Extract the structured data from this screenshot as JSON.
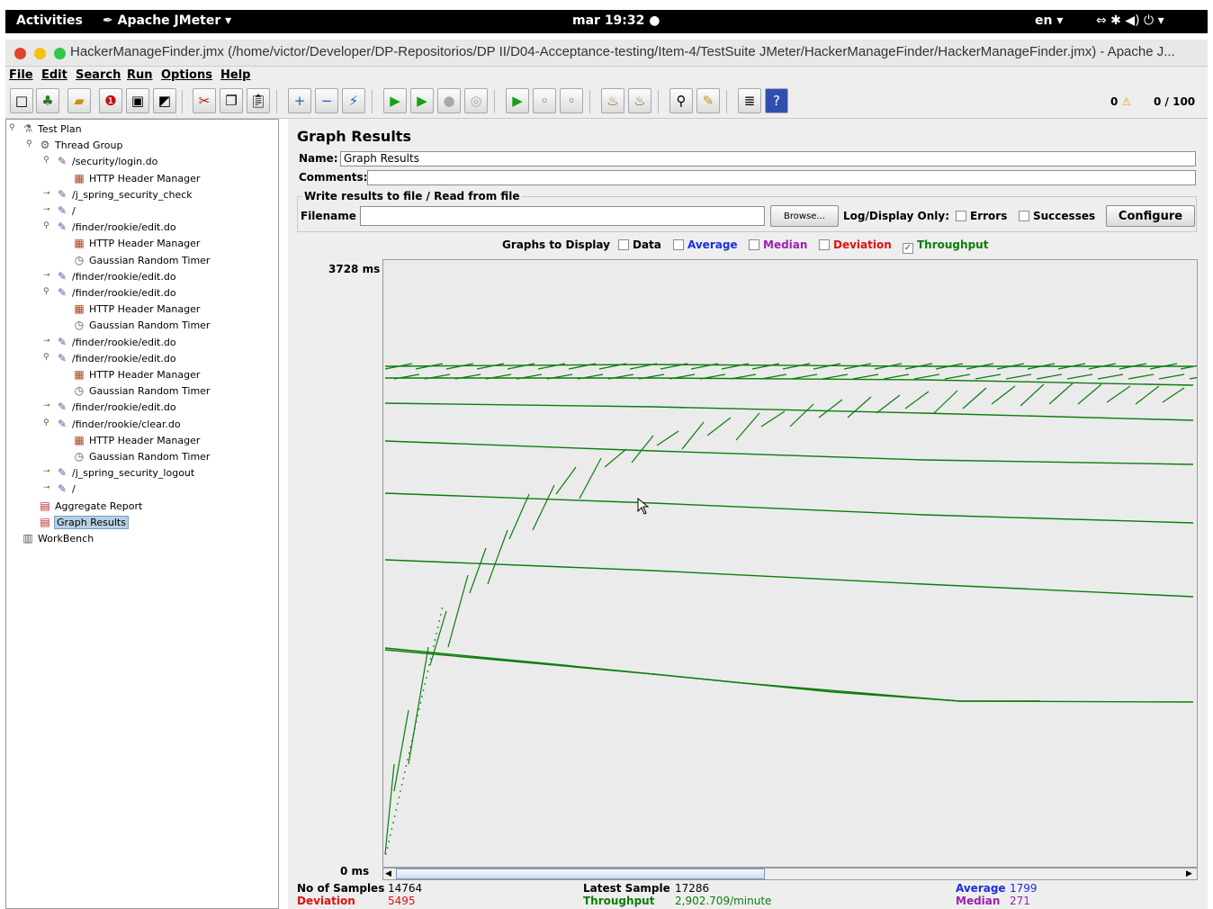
{
  "topbar": {
    "activities": "Activities",
    "app": "Apache JMeter ▾",
    "clock": "mar 19:32 ●",
    "lang": "en ▾",
    "tray": "⇔  ✱  ◀)  ⏻ ▾"
  },
  "window": {
    "title": "HackerManageFinder.jmx (/home/victor/Developer/DP-Repositorios/DP II/D04-Acceptance-testing/Item-4/TestSuite JMeter/HackerManageFinder/HackerManageFinder.jmx) - Apache J..."
  },
  "menu": [
    "File",
    "Edit",
    "Search",
    "Run",
    "Options",
    "Help"
  ],
  "toolbar": {
    "warnings": "0",
    "progress": "0 / 100"
  },
  "tree": [
    {
      "label": "Test Plan",
      "icon": "test-plan-icon",
      "glyph": "⚗"
    },
    {
      "label": "Thread Group",
      "icon": "thread-group-icon",
      "glyph": "⚙"
    },
    {
      "label": "/security/login.do",
      "icon": "sampler-icon",
      "glyph": "✎"
    },
    {
      "label": "HTTP Header Manager",
      "icon": "header-manager-icon",
      "glyph": "▦"
    },
    {
      "label": "/j_spring_security_check",
      "icon": "sampler-icon",
      "glyph": "✎"
    },
    {
      "label": "/",
      "icon": "sampler-icon",
      "glyph": "✎"
    },
    {
      "label": "/finder/rookie/edit.do",
      "icon": "sampler-icon",
      "glyph": "✎"
    },
    {
      "label": "HTTP Header Manager",
      "icon": "header-manager-icon",
      "glyph": "▦"
    },
    {
      "label": "Gaussian Random Timer",
      "icon": "timer-icon",
      "glyph": "◷"
    },
    {
      "label": "/finder/rookie/edit.do",
      "icon": "sampler-icon",
      "glyph": "✎"
    },
    {
      "label": "/finder/rookie/edit.do",
      "icon": "sampler-icon",
      "glyph": "✎"
    },
    {
      "label": "HTTP Header Manager",
      "icon": "header-manager-icon",
      "glyph": "▦"
    },
    {
      "label": "Gaussian Random Timer",
      "icon": "timer-icon",
      "glyph": "◷"
    },
    {
      "label": "/finder/rookie/edit.do",
      "icon": "sampler-icon",
      "glyph": "✎"
    },
    {
      "label": "/finder/rookie/edit.do",
      "icon": "sampler-icon",
      "glyph": "✎"
    },
    {
      "label": "HTTP Header Manager",
      "icon": "header-manager-icon",
      "glyph": "▦"
    },
    {
      "label": "Gaussian Random Timer",
      "icon": "timer-icon",
      "glyph": "◷"
    },
    {
      "label": "/finder/rookie/edit.do",
      "icon": "sampler-icon",
      "glyph": "✎"
    },
    {
      "label": "/finder/rookie/clear.do",
      "icon": "sampler-icon",
      "glyph": "✎"
    },
    {
      "label": "HTTP Header Manager",
      "icon": "header-manager-icon",
      "glyph": "▦"
    },
    {
      "label": "Gaussian Random Timer",
      "icon": "timer-icon",
      "glyph": "◷"
    },
    {
      "label": "/j_spring_security_logout",
      "icon": "sampler-icon",
      "glyph": "✎"
    },
    {
      "label": "/",
      "icon": "sampler-icon",
      "glyph": "✎"
    },
    {
      "label": "Aggregate Report",
      "icon": "listener-icon",
      "glyph": "▤"
    },
    {
      "label": "Graph Results",
      "icon": "listener-icon",
      "glyph": "▤",
      "selected": true
    },
    {
      "label": "WorkBench",
      "icon": "workbench-icon",
      "glyph": "▥"
    }
  ],
  "panel": {
    "title": "Graph Results",
    "name_label": "Name:",
    "name_value": "Graph Results",
    "comments_label": "Comments:",
    "comments_value": "",
    "file_legend": "Write results to file / Read from file",
    "filename_label": "Filename",
    "filename_value": "",
    "browse": "Browse...",
    "log_display": "Log/Display Only:",
    "errors": "Errors",
    "successes": "Successes",
    "configure": "Configure",
    "graphs_to_display": "Graphs to Display",
    "toggles": {
      "data": "Data",
      "average": "Average",
      "median": "Median",
      "deviation": "Deviation",
      "throughput": "Throughput"
    }
  },
  "colors": {
    "average": "#1a2ee0",
    "median": "#9b1fb0",
    "deviation": "#e01010",
    "throughput": "#0b7d0b",
    "selection": "#b8cfe5"
  },
  "chart_data": {
    "type": "line",
    "series": [
      {
        "name": "Throughput",
        "color": "#0b7d0b"
      }
    ],
    "y_max_label": "3728 ms",
    "y_min_label": "0 ms",
    "ylim": [
      0,
      3728
    ]
  },
  "stats": {
    "samples_label": "No of Samples",
    "samples": "14764",
    "latest_label": "Latest Sample",
    "latest": "17286",
    "average_label": "Average",
    "average": "1799",
    "deviation_label": "Deviation",
    "deviation": "5495",
    "throughput_label": "Throughput",
    "throughput": "2,902.709/minute",
    "median_label": "Median",
    "median": "271"
  }
}
